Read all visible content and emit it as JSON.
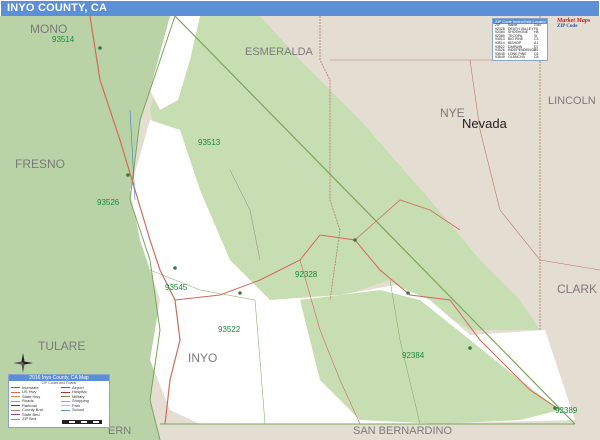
{
  "title": "INYO COUNTY, CA",
  "logo": {
    "brand": "Market Maps",
    "sub": "ZIP Code"
  },
  "states": {
    "nevada": "Nevada"
  },
  "counties": {
    "mono": "MONO",
    "esmeralda": "ESMERALDA",
    "nye": "NYE",
    "lincoln": "LINCOLN",
    "fresno": "FRESNO",
    "tulare": "TULARE",
    "inyo": "INYO",
    "clark": "CLARK",
    "san_bernardino": "SAN BERNARDINO",
    "kern": "ERN"
  },
  "zips": [
    "93514",
    "93513",
    "93526",
    "93545",
    "93522",
    "92328",
    "92384",
    "92389"
  ],
  "zip_index": {
    "title": "ZIP Code Index/Grid Locator",
    "columns": [
      "ZIP",
      "Name",
      "Grid"
    ],
    "rows": [
      [
        "92328",
        "DEATH VALLEY",
        "F6"
      ],
      [
        "92384",
        "SHOSHONE",
        "H8"
      ],
      [
        "92389",
        "TECOPA",
        "I9"
      ],
      [
        "93513",
        "BIG PINE",
        "C3"
      ],
      [
        "93514",
        "BISHOP",
        "A1"
      ],
      [
        "93522",
        "DARWIN",
        "D7"
      ],
      [
        "93526",
        "INDEPENDENCE",
        "B5"
      ],
      [
        "93545",
        "LONE PINE",
        "C6"
      ],
      [
        "93549",
        "OLANCHA",
        "C8"
      ]
    ]
  },
  "legend": {
    "title": "2016 Inyo County, CA Map",
    "subtitle": "ZIP Codes and Roads",
    "items_left": [
      "Interstate",
      "US Hwy",
      "State Hwy",
      "Roads",
      "Railroad",
      "County Bnd",
      "State Bnd",
      "ZIP Bnd",
      "Water",
      "Parks",
      "Cities"
    ],
    "items_right": [
      "Airport",
      "Hospital",
      "Military",
      "Shopping",
      "Park",
      "School"
    ]
  },
  "colors": {
    "title_bar": "#5b8fd6",
    "inyo_fill": "#ffffff",
    "park_green": "#c4dcb0",
    "forest_green": "#a9c99a",
    "outside_tan": "#e4ddd2",
    "highway_red": "#d26a5a",
    "county_line": "#7aa55c",
    "zip_label": "#1a8a3a"
  },
  "icons": [
    "compass-rose-icon",
    "scale-bar-icon"
  ]
}
